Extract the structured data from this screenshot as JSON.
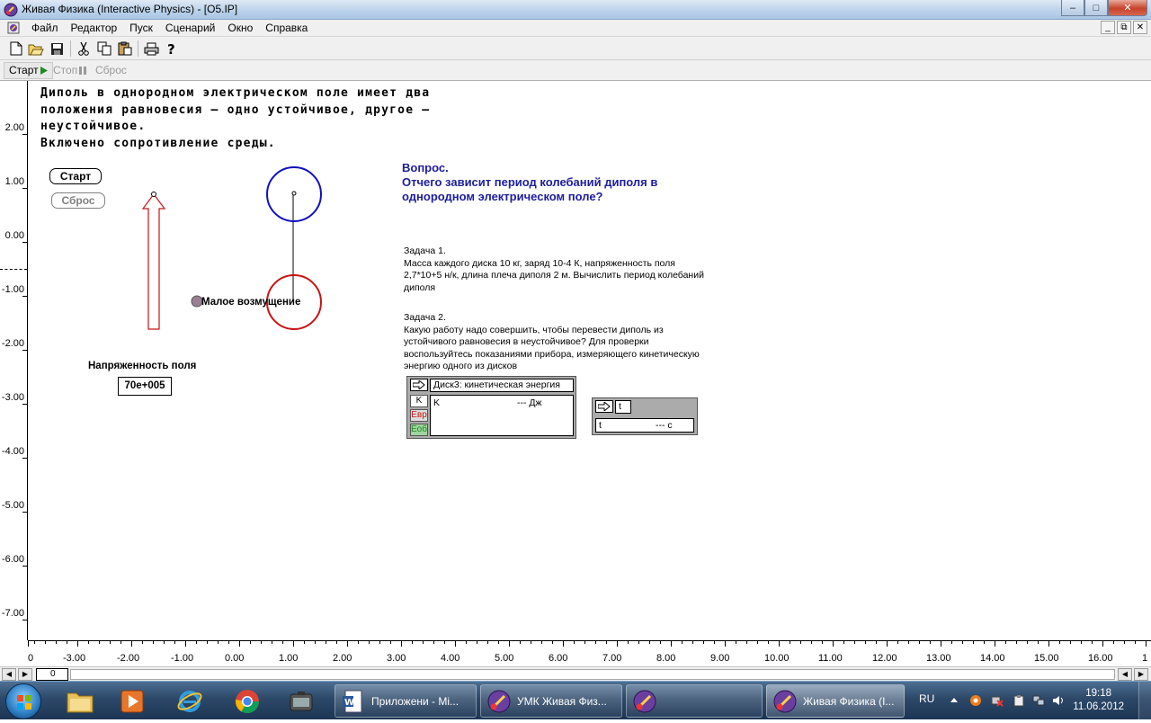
{
  "window": {
    "title": "Живая Физика (Interactive Physics) - [O5.IP]",
    "min_glyph": "–",
    "max_glyph": "□",
    "close_glyph": "✕"
  },
  "menu": {
    "items": [
      "Файл",
      "Редактор",
      "Пуск",
      "Сценарий",
      "Окно",
      "Справка"
    ],
    "mdi_min": "_",
    "mdi_restore": "⧉",
    "mdi_close": "✕"
  },
  "runbar": {
    "start_label": "Старт",
    "stop_label": "Стоп",
    "reset_label": "Сброс"
  },
  "left_ruler": {
    "labels": [
      "2.00",
      "1.00",
      "0.00",
      "-1.00",
      "-2.00",
      "-3.00",
      "-4.00",
      "-5.00",
      "-6.00",
      "-7.00"
    ]
  },
  "canvas": {
    "description": "Диполь в однородном электрическом поле имеет два\nположения равновесия — одно устойчивое, другое —\nнеустойчивое.\nВключено сопротивление среды.",
    "start_button": "Старт",
    "reset_button": "Сброс",
    "question_title": "Вопрос.",
    "question_text_1": "Отчего зависит период колебаний диполя в",
    "question_text_2": "однородном электрическом поле?",
    "task1_title": "Задача 1.",
    "task1_text": "Масса каждого диска 10 кг, заряд 10-4 К, напряженность поля 2,7*10+5 н/к, длина плеча диполя 2 м. Вычислить период колебаний диполя",
    "task2_title": "Задача 2.",
    "task2_text": "Какую работу надо совершить, чтобы перевести диполь из устойчивого равновесия в неустойчивое? Для проверки воспользуйтесь показаниями прибора, измеряющего кинетическую энергию одного из дисков",
    "field_label": "Напряженность поля",
    "field_value": "70e+005",
    "perturbation_label": "Малое возмущение",
    "meter1": {
      "title": "Диск3: кинетическая энергия",
      "side_k": "K",
      "side_evr": "Евр",
      "side_epot": "Eоб",
      "row_label": "K",
      "row_value": "--- Дж"
    },
    "meter2": {
      "title": "t",
      "row_label": "t",
      "row_value": "--- c"
    },
    "colors": {
      "upper_disk": "#1010c0",
      "lower_disk": "#c81414",
      "question": "#1d1d9e"
    }
  },
  "bottom_ruler": {
    "labels": [
      "0",
      "-3.00",
      "-2.00",
      "-1.00",
      "0.00",
      "1.00",
      "2.00",
      "3.00",
      "4.00",
      "5.00",
      "6.00",
      "7.00",
      "8.00",
      "9.00",
      "10.00",
      "11.00",
      "12.00",
      "13.00",
      "14.00",
      "15.00",
      "16.00",
      "1"
    ]
  },
  "scrollbar": {
    "frame_value": "0"
  },
  "taskbar": {
    "tasks": [
      "Приложени - Mi...",
      "УМК Живая Физ...",
      "",
      "Живая Физика (I..."
    ],
    "language": "RU",
    "time": "19:18",
    "date": "11.06.2012"
  }
}
